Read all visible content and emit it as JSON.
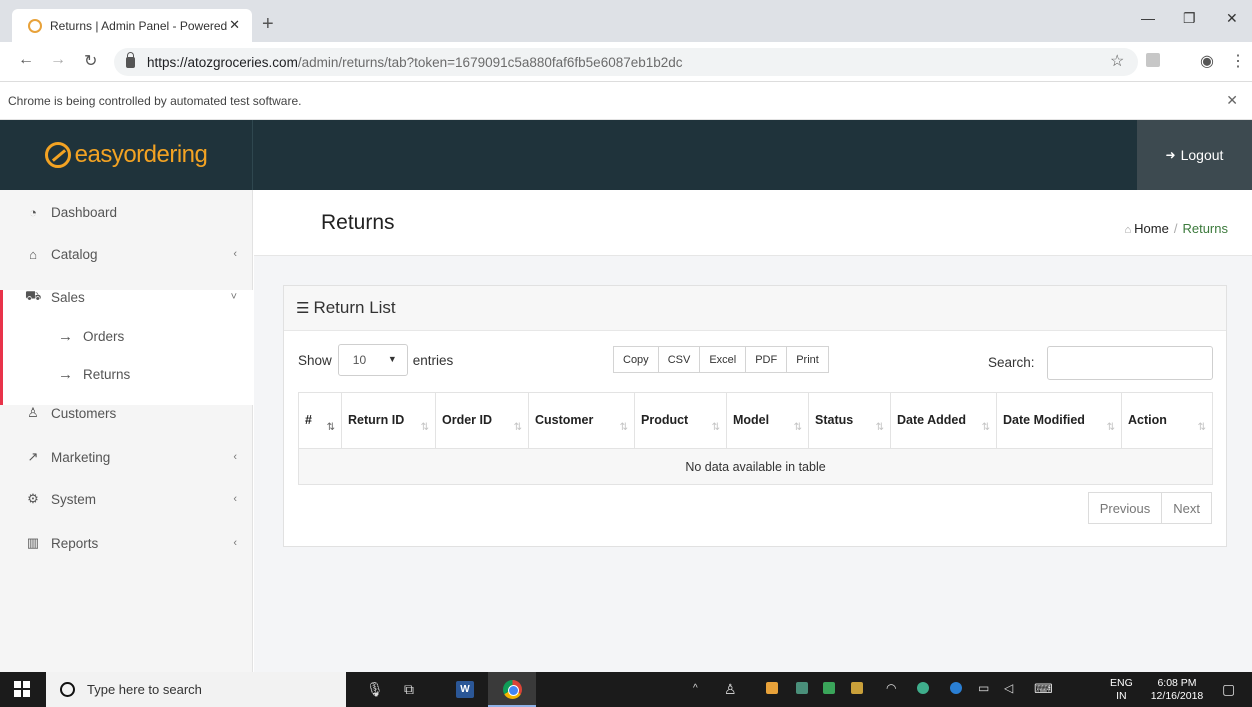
{
  "browser": {
    "tab_title": "Returns | Admin Panel - Powered",
    "new_tab": "+",
    "url_host": "https://atozgroceries.com",
    "url_path": "/admin/returns/tab?token=1679091c5a880faf6fb5e6087eb1b2dc",
    "infobar": "Chrome is being controlled by automated test software."
  },
  "header": {
    "logo": "easyordering",
    "logout_label": "Logout"
  },
  "sidebar": {
    "items": [
      {
        "label": "Dashboard",
        "icon": "dashboard-icon"
      },
      {
        "label": "Catalog",
        "icon": "tag-icon"
      },
      {
        "label": "Sales",
        "icon": "cart-icon"
      },
      {
        "label": "Customers",
        "icon": "user-icon"
      },
      {
        "label": "Marketing",
        "icon": "share-icon"
      },
      {
        "label": "System",
        "icon": "gear-icon"
      },
      {
        "label": "Reports",
        "icon": "bar-chart-icon"
      }
    ],
    "sales_sub": [
      {
        "label": "Orders"
      },
      {
        "label": "Returns"
      }
    ]
  },
  "page": {
    "title": "Returns",
    "breadcrumb_home": "Home",
    "breadcrumb_sep": "/",
    "breadcrumb_current": "Returns"
  },
  "panel": {
    "title": "Return List",
    "show_label": "Show",
    "entries_label": "entries",
    "page_length": "10",
    "export_buttons": [
      "Copy",
      "CSV",
      "Excel",
      "PDF",
      "Print"
    ],
    "search_label": "Search:",
    "search_value": ""
  },
  "table": {
    "columns": [
      "#",
      "Return ID",
      "Order ID",
      "Customer",
      "Product",
      "Model",
      "Status",
      "Date Added",
      "Date Modified",
      "Action"
    ],
    "empty_message": "No data available in table"
  },
  "pagination": {
    "previous": "Previous",
    "next": "Next"
  },
  "taskbar": {
    "search_placeholder": "Type here to search",
    "lang_top": "ENG",
    "lang_bottom": "IN",
    "time": "6:08 PM",
    "date": "12/16/2018"
  },
  "colors": {
    "header_bg": "#1f333b",
    "logo_orange": "#f3a323",
    "sales_accent": "#e8334a",
    "breadcrumb_active": "#3c7a3c"
  }
}
